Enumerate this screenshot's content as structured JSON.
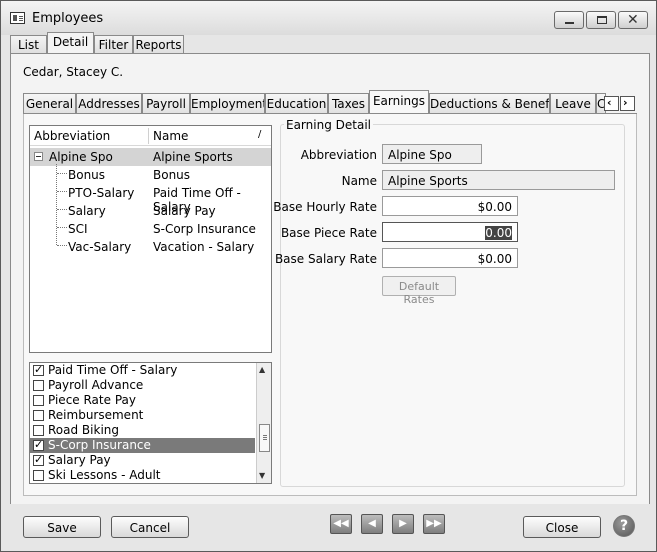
{
  "window": {
    "title": "Employees"
  },
  "top_tabs": [
    "List",
    "Detail",
    "Filter",
    "Reports"
  ],
  "employee": {
    "name": "Cedar, Stacey C."
  },
  "sub_tabs": [
    "General",
    "Addresses",
    "Payroll",
    "Employment",
    "Education",
    "Taxes",
    "Earnings",
    "Deductions & Benefits",
    "Leave",
    "C"
  ],
  "tree": {
    "headers": {
      "abbreviation": "Abbreviation",
      "name": "Name"
    },
    "parent": {
      "abbr": "Alpine Spo",
      "name": "Alpine Sports"
    },
    "children": [
      {
        "abbr": "Bonus",
        "name": "Bonus"
      },
      {
        "abbr": "PTO-Salary",
        "name": "Paid Time Off - Salary"
      },
      {
        "abbr": "Salary",
        "name": "Salary Pay"
      },
      {
        "abbr": "SCI",
        "name": "S-Corp Insurance"
      },
      {
        "abbr": "Vac-Salary",
        "name": "Vacation - Salary"
      }
    ]
  },
  "checklist": [
    {
      "label": "Paid Time Off - Salary",
      "checked": true
    },
    {
      "label": "Payroll Advance",
      "checked": false
    },
    {
      "label": "Piece Rate Pay",
      "checked": false
    },
    {
      "label": "Reimbursement",
      "checked": false
    },
    {
      "label": "Road Biking",
      "checked": false
    },
    {
      "label": "S-Corp Insurance",
      "checked": true
    },
    {
      "label": "Salary Pay",
      "checked": true
    },
    {
      "label": "Ski Lessons - Adult",
      "checked": false
    }
  ],
  "detail": {
    "title": "Earning Detail",
    "abbreviation_label": "Abbreviation",
    "abbreviation_value": "Alpine Spo",
    "name_label": "Name",
    "name_value": "Alpine Sports",
    "hourly_label": "Base Hourly Rate",
    "hourly_value": "$0.00",
    "piece_label": "Base Piece Rate",
    "piece_value": "0.00",
    "salary_label": "Base Salary Rate",
    "salary_value": "$0.00",
    "default_rates_label": "Default Rates"
  },
  "footer": {
    "save": "Save",
    "cancel": "Cancel",
    "close": "Close",
    "help": "?"
  }
}
